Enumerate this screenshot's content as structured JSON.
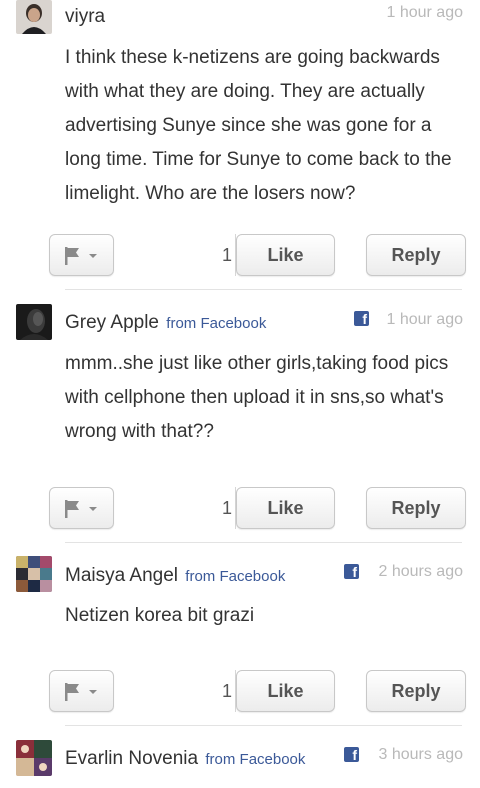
{
  "comments": [
    {
      "author": "viyra",
      "source": "",
      "time": "1 hour ago",
      "text": "I think these k-netizens are going backwards with what they are doing.  They are actually advertising Sunye since she was gone for a long time.  Time for Sunye to come back to the limelight.  Who are the losers now?",
      "likes": "1",
      "like_label": "Like",
      "reply_label": "Reply"
    },
    {
      "author": "Grey Apple",
      "source": "from Facebook",
      "time": "1 hour ago",
      "text": "mmm..she just like other girls,taking food pics with cellphone then upload it in sns,so what's wrong with that??",
      "likes": "1",
      "like_label": "Like",
      "reply_label": "Reply"
    },
    {
      "author": "Maisya Angel",
      "source": "from Facebook",
      "time": "2 hours ago",
      "text": "Netizen korea bit grazi",
      "likes": "1",
      "like_label": "Like",
      "reply_label": "Reply"
    },
    {
      "author": "Evarlin Novenia",
      "source": "from Facebook",
      "time": "3 hours ago"
    }
  ],
  "colors": {
    "facebook_blue": "#3b5998",
    "timestamp_gray": "#b9b9b9",
    "text": "#333333"
  },
  "icons": {
    "flag": "flag-icon",
    "dropdown": "chevron-down-icon",
    "facebook": "facebook-icon"
  }
}
